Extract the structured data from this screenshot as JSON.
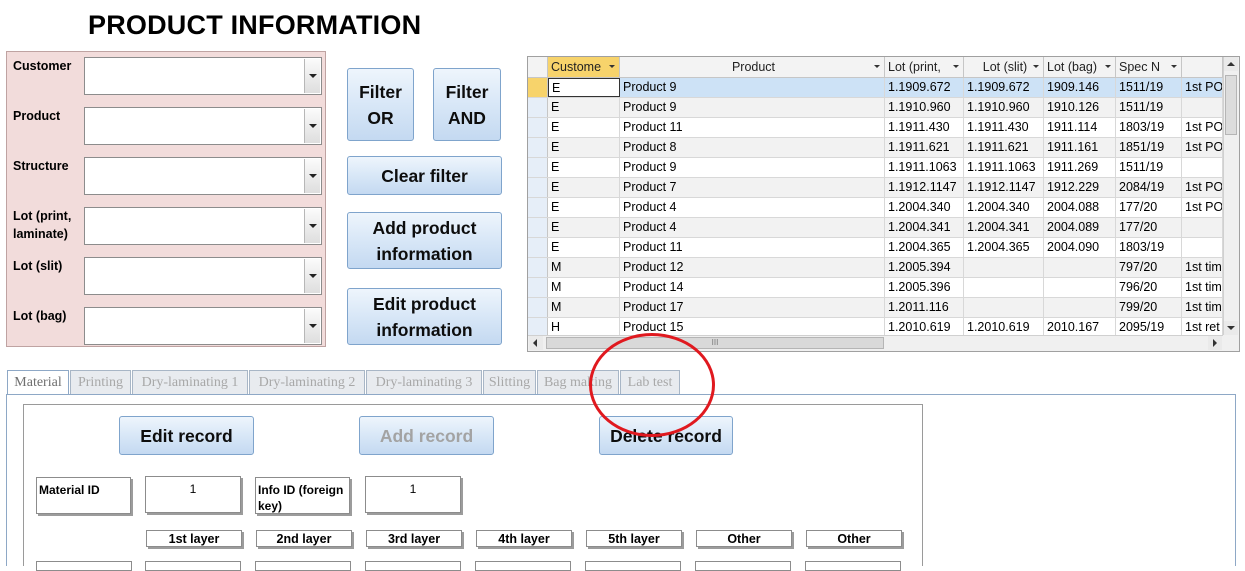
{
  "page": {
    "title": "PRODUCT INFORMATION"
  },
  "filters": [
    {
      "label": "Customer",
      "value": ""
    },
    {
      "label": "Product",
      "value": ""
    },
    {
      "label": "Structure",
      "value": ""
    },
    {
      "label": "Lot (print, laminate)",
      "value": ""
    },
    {
      "label": "Lot (slit)",
      "value": ""
    },
    {
      "label": "Lot (bag)",
      "value": ""
    }
  ],
  "buttons": {
    "filter_or": "Filter OR",
    "filter_and": "Filter AND",
    "clear_filter": "Clear filter",
    "add_product_info": "Add product information",
    "edit_product_info": "Edit product information"
  },
  "grid": {
    "columns": [
      "Custome",
      "Product",
      "Lot (print,",
      "Lot (slit)",
      "Lot (bag)",
      "Spec N",
      ""
    ],
    "rows": [
      [
        "E",
        "Product 9",
        "1.1909.672",
        "1.1909.672",
        "1909.146",
        "1511/19",
        "1st PO"
      ],
      [
        "E",
        "Product 9",
        "1.1910.960",
        "1.1910.960",
        "1910.126",
        "1511/19",
        ""
      ],
      [
        "E",
        "Product 11",
        "1.1911.430",
        "1.1911.430",
        "1911.114",
        "1803/19",
        "1st PO"
      ],
      [
        "E",
        "Product 8",
        "1.1911.621",
        "1.1911.621",
        "1911.161",
        "1851/19",
        "1st PO"
      ],
      [
        "E",
        "Product 9",
        "1.1911.1063",
        "1.1911.1063",
        "1911.269",
        "1511/19",
        ""
      ],
      [
        "E",
        "Product 7",
        "1.1912.1147",
        "1.1912.1147",
        "1912.229",
        "2084/19",
        "1st PO"
      ],
      [
        "E",
        "Product 4",
        "1.2004.340",
        "1.2004.340",
        "2004.088",
        "177/20",
        "1st PO"
      ],
      [
        "E",
        "Product 4",
        "1.2004.341",
        "1.2004.341",
        "2004.089",
        "177/20",
        ""
      ],
      [
        "E",
        "Product 11",
        "1.2004.365",
        "1.2004.365",
        "2004.090",
        "1803/19",
        ""
      ],
      [
        "M",
        "Product 12",
        "1.2005.394",
        "",
        "",
        "797/20",
        "1st tim"
      ],
      [
        "M",
        "Product 14",
        "1.2005.396",
        "",
        "",
        "796/20",
        "1st tim"
      ],
      [
        "M",
        "Product 17",
        "1.2011.116",
        "",
        "",
        "799/20",
        "1st tim"
      ],
      [
        "H",
        "Product 15",
        "1.2010.619",
        "1.2010.619",
        "2010.167",
        "2095/19",
        "1st ret"
      ]
    ],
    "scroll_grip": "III"
  },
  "tabs": [
    "Material",
    "Printing",
    "Dry-laminating 1",
    "Dry-laminating 2",
    "Dry-laminating 3",
    "Slitting",
    "Bag making",
    "Lab test"
  ],
  "subform": {
    "edit_record": "Edit record",
    "add_record": "Add record",
    "delete_record": "Delete record",
    "material_id_label": "Material ID",
    "material_id_value": "1",
    "info_id_label": "Info ID (foreign key)",
    "info_id_value": "1",
    "layers": [
      "1st layer",
      "2nd layer",
      "3rd layer",
      "4th layer",
      "5th layer",
      "Other",
      "Other"
    ]
  },
  "colors": {
    "filter_panel_bg": "#f2dcdb",
    "button_gradient_top": "#eef5fc",
    "button_gradient_bottom": "#c4d9f1",
    "selected_row": "#cde2f6",
    "active_header": "#f7d36b",
    "annotation": "#e0191f"
  }
}
